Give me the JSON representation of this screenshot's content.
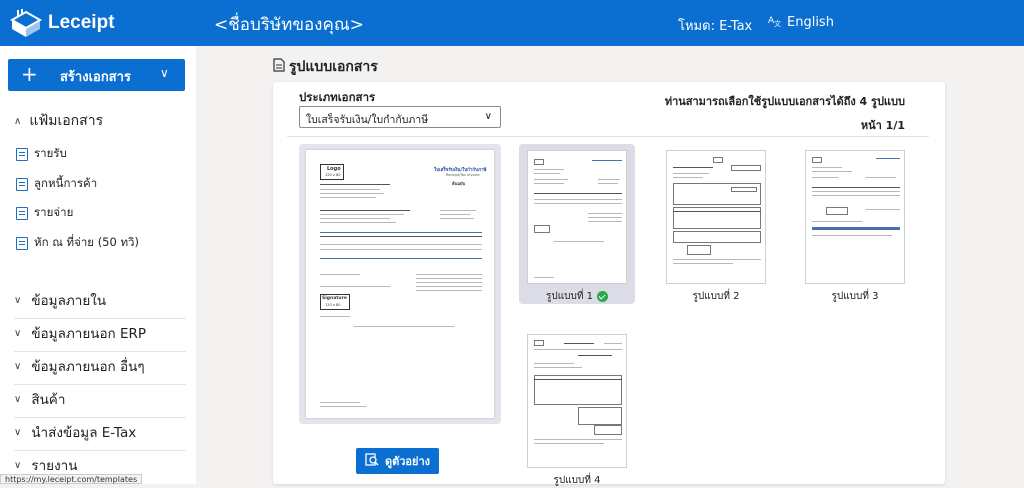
{
  "topbar": {
    "brand": "Leceipt",
    "company": "<ชื่อบริษัทของคุณ>",
    "mode": "โหมด: E-Tax",
    "language": "English"
  },
  "sidebar": {
    "create_label": "สร้างเอกสาร",
    "folder_label": "แฟ้มเอกสาร",
    "folder_items": [
      "รายรับ",
      "ลูกหนี้การค้า",
      "รายจ่าย",
      "หัก ณ ที่จ่าย (50 ทวิ)"
    ],
    "sections": [
      "ข้อมูลภายใน",
      "ข้อมูลภายนอก ERP",
      "ข้อมูลภายนอก อื่นๆ",
      "สินค้า",
      "นำส่งข้อมูล E-Tax",
      "รายงาน"
    ]
  },
  "status_url": "https://my.leceipt.com/templates",
  "main": {
    "title": "รูปแบบเอกสาร",
    "doc_type_label": "ประเภทเอกสาร",
    "doc_type_value": "ใบเสร็จรับเงิน/ใบกำกับภาษี",
    "available_text": "ท่านสามารถเลือกใช้รูปแบบเอกสารได้ถึง 4 รูปแบบ",
    "page_info": "หน้า 1/1",
    "view_button": "ดูตัวอย่าง",
    "preview": {
      "logo_text": "Logo",
      "logo_size": "120 x 80",
      "doc_title": "ใบเสร็จรับเงิน/ใบกำกับภาษี",
      "doc_subtitle": "Receipt/Tax Invoice",
      "original": "ต้นฉบับ",
      "signature_text": "Signature",
      "signature_size": "120 x 80"
    },
    "templates": [
      {
        "name": "รูปแบบที่ 1",
        "selected": true
      },
      {
        "name": "รูปแบบที่ 2",
        "selected": false
      },
      {
        "name": "รูปแบบที่ 3",
        "selected": false
      },
      {
        "name": "รูปแบบที่ 4",
        "selected": false
      }
    ]
  },
  "icons": {
    "plus": "plus-icon",
    "chevron": "chevron-down-icon",
    "language": "translate-icon",
    "document": "document-icon",
    "check": "check-circle-icon",
    "preview": "preview-icon"
  },
  "colors": {
    "primary": "#0a6fd0",
    "selected_bg": "#dcdce6",
    "check": "#2aa84a"
  }
}
